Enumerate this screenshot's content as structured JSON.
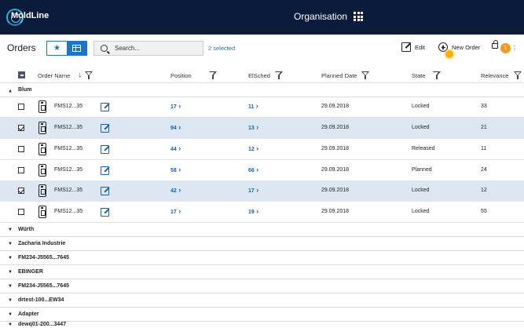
{
  "header": {
    "logo_text": "MoldLine",
    "organisation_label": "Organisation"
  },
  "toolbar": {
    "title": "Orders",
    "search_placeholder": "Search...",
    "selected_text": "2 selected",
    "edit_label": "Edit",
    "new_order_label": "New Order",
    "notification_count": "1"
  },
  "columns": {
    "order_name": "Order Name",
    "position": "Position",
    "elsched": "ElSched",
    "planned_date": "Planned Date",
    "state": "State",
    "relevance": "Relevance"
  },
  "groups": [
    {
      "label": "Blum",
      "expanded": true
    },
    {
      "label": "Würth",
      "expanded": false
    },
    {
      "label": "Zacharia Industrie",
      "expanded": false
    },
    {
      "label": "FM234-J5565...7645",
      "expanded": false
    },
    {
      "label": "EBINGER",
      "expanded": false
    },
    {
      "label": "FM234-J5565...7645",
      "expanded": false
    },
    {
      "label": "drtest-100...EW34",
      "expanded": false
    },
    {
      "label": "Adapter",
      "expanded": false
    },
    {
      "label": "dewq01-200...3447",
      "expanded": false
    }
  ],
  "rows": [
    {
      "checked": false,
      "order_name": "FMS12...35",
      "position": "17",
      "elsched": "11",
      "planned_date": "29.09.2018",
      "state": "Locked",
      "relevance": "33"
    },
    {
      "checked": true,
      "order_name": "FMS12...35",
      "position": "94",
      "elsched": "13",
      "planned_date": "29.09.2018",
      "state": "Locked",
      "relevance": "21"
    },
    {
      "checked": false,
      "order_name": "FMS12...35",
      "position": "44",
      "elsched": "12",
      "planned_date": "29.09.2018",
      "state": "Released",
      "relevance": "11"
    },
    {
      "checked": false,
      "order_name": "FMS12...35",
      "position": "58",
      "elsched": "66",
      "planned_date": "29.09.2018",
      "state": "Planned",
      "relevance": "24"
    },
    {
      "checked": true,
      "order_name": "FMS12...35",
      "position": "42",
      "elsched": "17",
      "planned_date": "29.09.2018",
      "state": "Locked",
      "relevance": "12"
    },
    {
      "checked": false,
      "order_name": "FMS12...35",
      "position": "17",
      "elsched": "19",
      "planned_date": "29.09.2018",
      "state": "Locked",
      "relevance": "55"
    }
  ],
  "colors": {
    "header_bg": "#0b1b3c",
    "accent": "#1d72c9",
    "selected_row": "#dde7f4",
    "badge": "#f19c1f",
    "hint": "#f5b301"
  }
}
